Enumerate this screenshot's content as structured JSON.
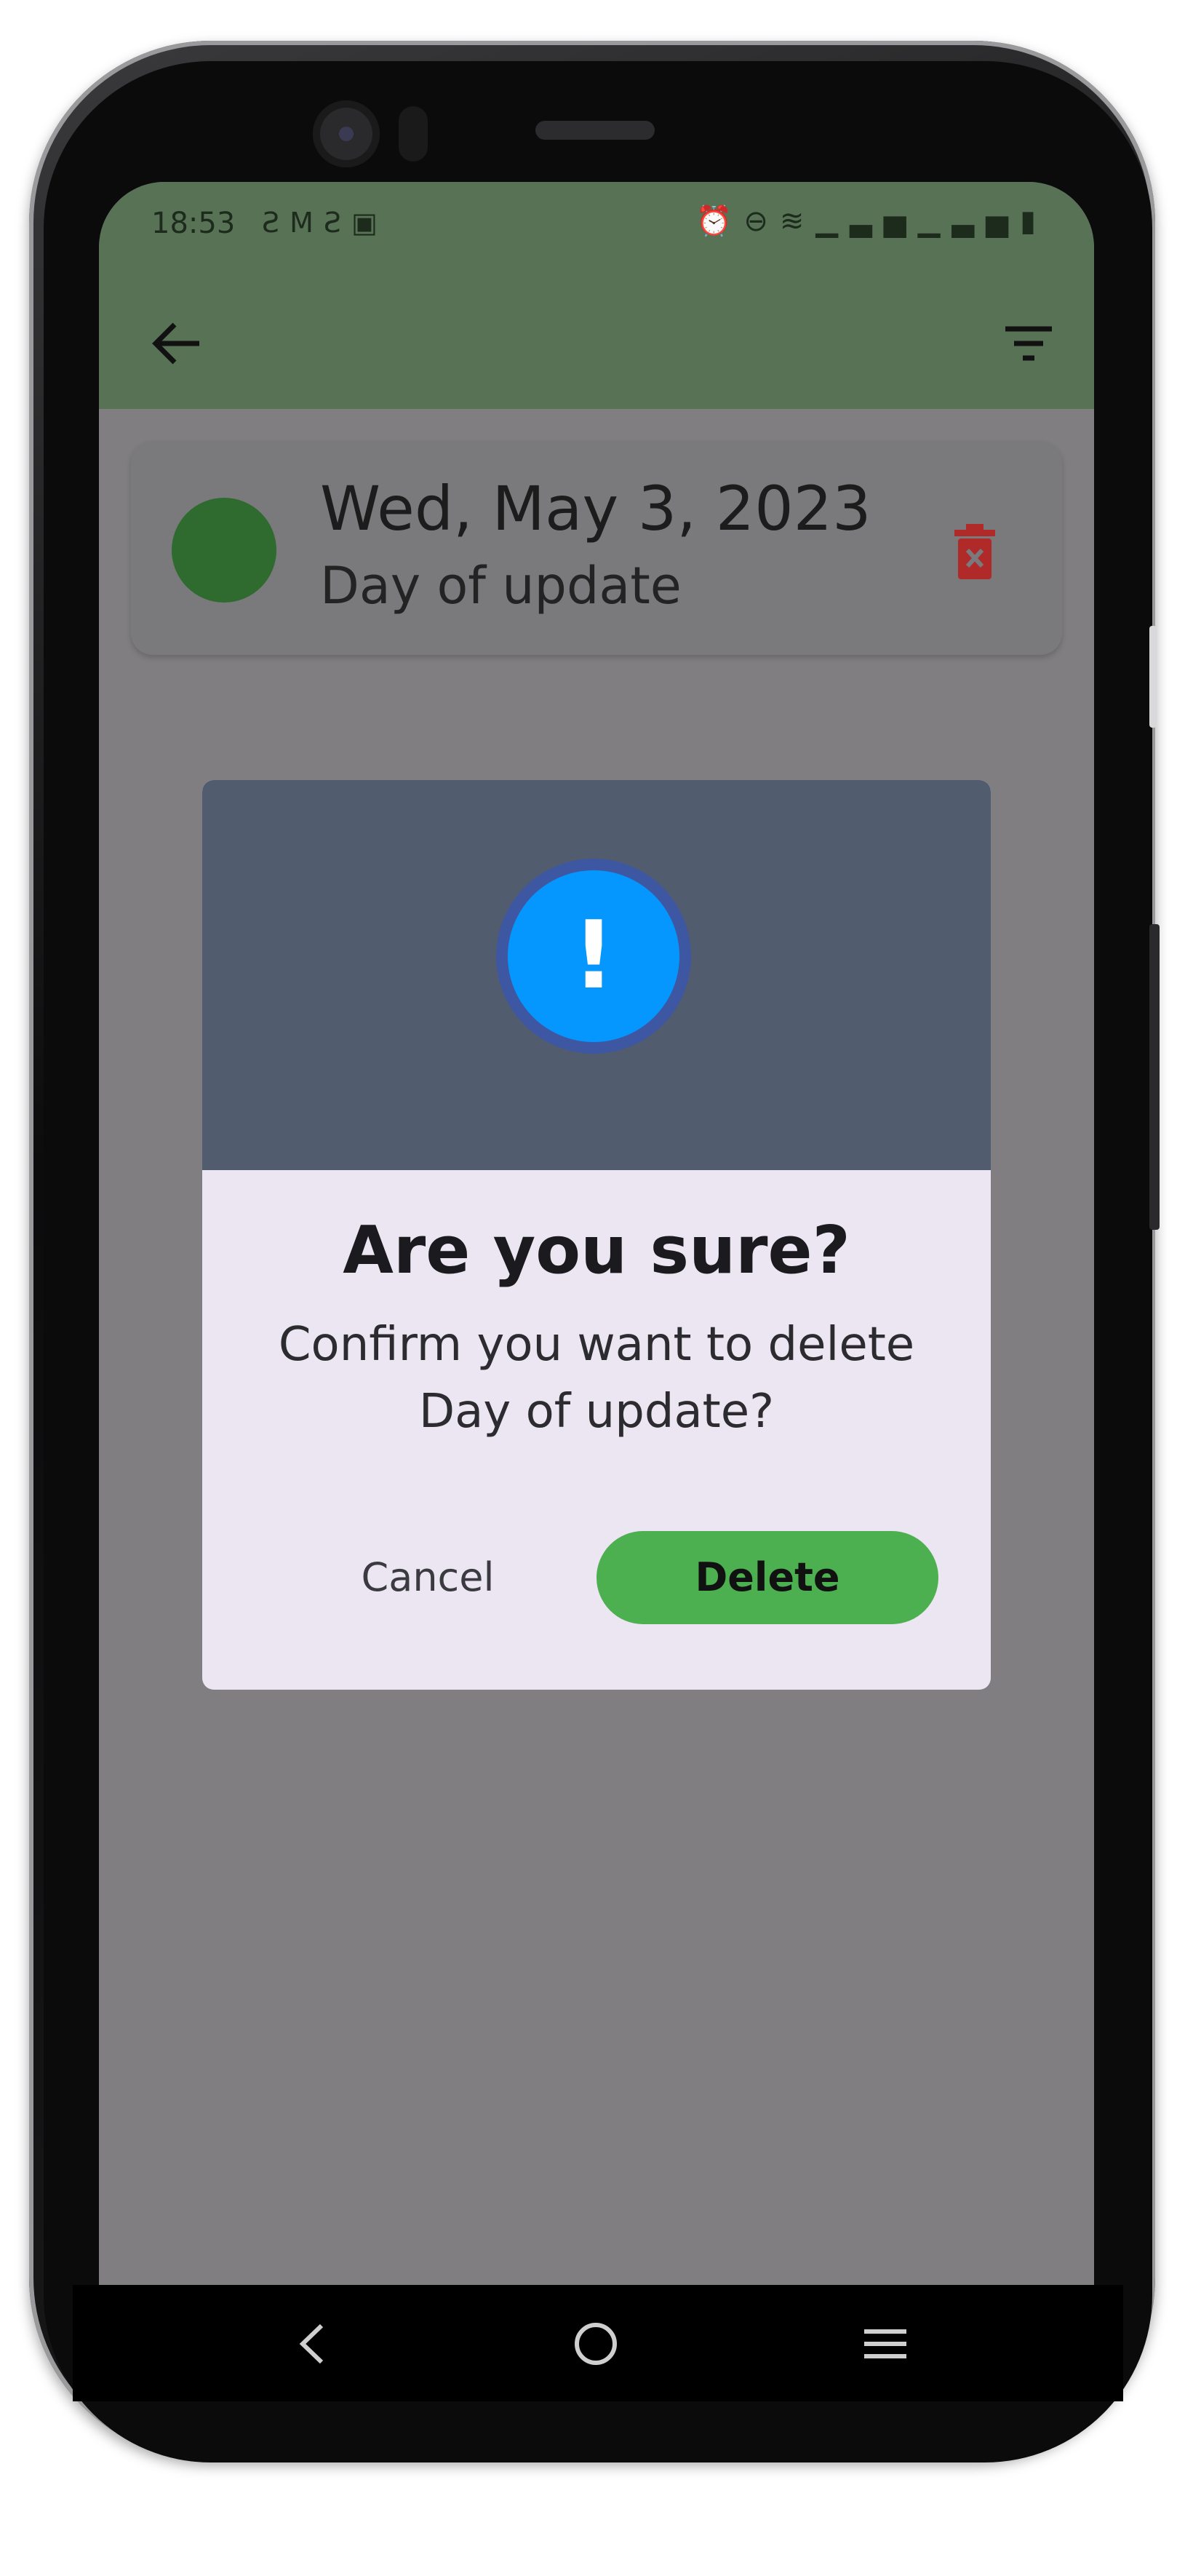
{
  "status_bar": {
    "time": "18:53",
    "left_icons": [
      "sim-icon",
      "gmail-icon",
      "sim-icon",
      "app-icon"
    ],
    "right_icons": [
      "alarm-icon",
      "dnd-icon",
      "wifi-icon",
      "signal-icon",
      "signal-icon",
      "battery-icon"
    ]
  },
  "toolbar": {
    "background": "#587256"
  },
  "entry": {
    "date": "Wed, May 3, 2023",
    "name": "Day of update",
    "dot_color": "#2f6a2f",
    "delete_icon_color": "#c62828"
  },
  "dialog": {
    "icon_symbol": "!",
    "title": "Are you sure?",
    "message_line1": "Confirm you want to delete",
    "message_line2": "Day of update?",
    "cancel_label": "Cancel",
    "delete_label": "Delete",
    "accent_color": "#4caf50",
    "icon_color": "#0597fd"
  },
  "navigation_bar": {
    "items": [
      "back",
      "home",
      "recents"
    ]
  }
}
